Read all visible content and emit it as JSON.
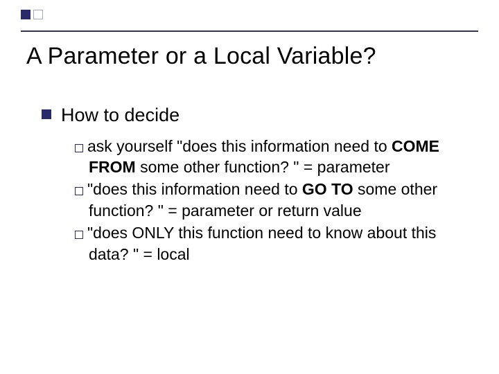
{
  "title": "A Parameter or a Local Variable?",
  "heading": "How to decide",
  "items": [
    {
      "pre": "ask yourself \"does this information need to ",
      "bold": "COME FROM",
      "post": " some other function? \" = parameter"
    },
    {
      "pre": "\"does this information need to ",
      "bold": "GO TO",
      "post": " some other function? \" = parameter or return value"
    },
    {
      "pre": "\"does ONLY this function need to know about this data? \" = local",
      "bold": "",
      "post": ""
    }
  ]
}
